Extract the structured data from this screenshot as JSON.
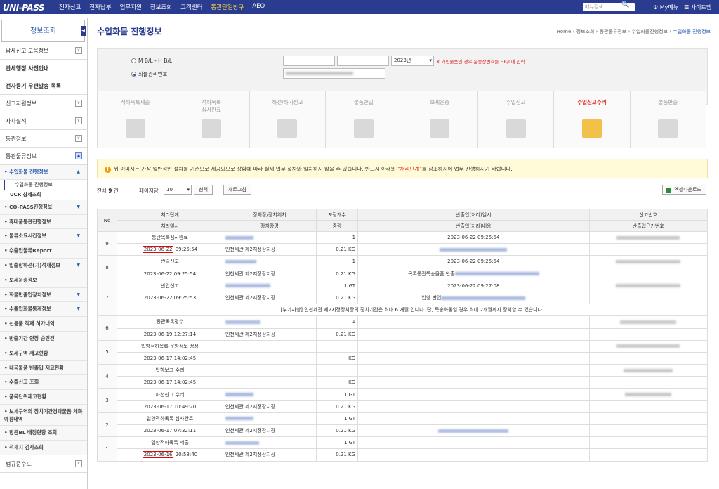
{
  "topbar": {
    "logo": "UNI-PASS",
    "menu": [
      "전자신고",
      "전자납부",
      "업무지원",
      "정보조회",
      "고객센터",
      "통관단일창구",
      "AEO"
    ],
    "search_placeholder": "메뉴검색",
    "my_menu": "My메뉴",
    "sitemap": "사이트맵"
  },
  "sidebar": {
    "title": "정보조회",
    "top_items": [
      {
        "label": "납세신고 도움정보",
        "toggle": "∨"
      },
      {
        "label": "관세행정 사전안내",
        "toggle": ""
      },
      {
        "label": "전자등기 우편발송 목록",
        "toggle": ""
      },
      {
        "label": "신고지원정보",
        "toggle": "∨"
      },
      {
        "label": "자사실적",
        "toggle": "∨"
      },
      {
        "label": "통관정보",
        "toggle": "∨"
      },
      {
        "label": "통관물류정보",
        "toggle": "▲"
      }
    ],
    "sub_open": "수입화물 진행정보",
    "leaf_active": "수입화물 진행정보",
    "leaf2": "UCR 상세조회",
    "subs": [
      {
        "label": "CO-PASS진행정보",
        "tri": "▼"
      },
      {
        "label": "휴대품통관진행정보",
        "tri": ""
      },
      {
        "label": "물류소요시간정보",
        "tri": "▼"
      },
      {
        "label": "수출입물류Report",
        "tri": ""
      },
      {
        "label": "입출항하선(기)적재정보",
        "tri": "▼"
      },
      {
        "label": "보세운송정보",
        "tri": ""
      },
      {
        "label": "화물반출입장치정보",
        "tri": "▼"
      },
      {
        "label": "수출입화물통계정보",
        "tri": "▼"
      },
      {
        "label": "선용품 적재 허가내역",
        "tri": ""
      },
      {
        "label": "반출기간 연장 승인건",
        "tri": ""
      },
      {
        "label": "보세구역 재고현황",
        "tri": ""
      },
      {
        "label": "내국물품 반출입 재고현황",
        "tri": ""
      },
      {
        "label": "수출신고 조회",
        "tri": ""
      },
      {
        "label": "품목단위재고현황",
        "tri": ""
      },
      {
        "label": "보세구역의 장치기간경과물품 체화 예정내역",
        "tri": ""
      },
      {
        "label": "항공BL 배정현황 조회",
        "tri": ""
      },
      {
        "label": "적재지 검사조회",
        "tri": ""
      }
    ],
    "bottom": "법규준수도"
  },
  "page": {
    "title": "수입화물 진행정보",
    "breadcrumb": [
      "Home",
      "정보조회",
      "통관물류정보",
      "수입화물진행정보",
      "수입화물 진행정보"
    ]
  },
  "search": {
    "opt1": "M B/L - H B/L",
    "opt2": "화물관리번호",
    "year": "2023년",
    "warn": "✕ 가인물품인 경우 운송장번호를 HB/L에 입력"
  },
  "steps": [
    {
      "label": "적하목록제출"
    },
    {
      "label": "적하목록\n심사완료"
    },
    {
      "label": "하선/하기신고"
    },
    {
      "label": "물품반입"
    },
    {
      "label": "보세운송"
    },
    {
      "label": "수입신고"
    },
    {
      "label": "수입신고수리"
    },
    {
      "label": "물품반출"
    }
  ],
  "notice": {
    "pre": "위 이미지는 가장 일반적인 절차를 기준으로 제공되므로 상황에 따라 실제 업무 절차와 일치하지 않을 수 있습니다. 반드시 아래의 ",
    "hl": "\"처리단계\"",
    "post": "를 참조하시어 업무 진행하시기 바랍니다."
  },
  "controls": {
    "total_pre": "전체 ",
    "total": "9",
    "total_post": " 건",
    "per_page": "페이지당",
    "per_page_val": "10",
    "select": "선택",
    "refresh": "새로고침",
    "excel": "엑셀다운로드"
  },
  "table": {
    "h1": [
      "No",
      "처리단계",
      "장치장/장치위치",
      "포장개수",
      "반출입(처리)일시",
      "신고번호"
    ],
    "h2": [
      "처리일시",
      "장치장명",
      "중량",
      "반출입(처리)내용",
      "반출입근거번호"
    ],
    "rows": [
      {
        "no": "9",
        "step": "통관목록심사완료",
        "date": "2023-06-22",
        "time": " 09:25:54",
        "place": "인천세관 제2지정장치장",
        "cnt": "1",
        "wt": "0.21 KG",
        "io_dt": "2023-06-22 09:25:54",
        "io_txt": "",
        "box": true
      },
      {
        "no": "8",
        "step": "반출신고",
        "date": "2023-06-22",
        "time": " 09:25:54",
        "place": "인천세관 제2지정장치장",
        "cnt": "1",
        "wt": "0.21 KG",
        "io_dt": "2023-06-22 09:25:54",
        "io_txt": "목록통관특송물품 반출",
        "box": false
      },
      {
        "no": "7",
        "step": "반입신고",
        "date": "2023-06-22",
        "time": " 09:25:53",
        "place": "인천세관 제2지정장치장",
        "cnt": "1 GT",
        "wt": "0.21 KG",
        "io_dt": "2023-06-22 09:27:08",
        "io_txt": "입항 반입",
        "box": false,
        "note": "[부가사항] 인천세관 제2지정장치장의 장치기간은 최대 6 개월 입니다. 단, 특송화물일 경우 최대 2개월까지 장치할 수 있습니다."
      },
      {
        "no": "6",
        "step": "통관목록접수",
        "date": "2023-06-19",
        "time": " 12:27:14",
        "place": "인천세관 제2지정장치장",
        "cnt": "1",
        "wt": "0.21 KG",
        "io_dt": "",
        "io_txt": "",
        "box": false
      },
      {
        "no": "5",
        "step": "입항적하목록 운항정보 정정",
        "date": "2023-06-17",
        "time": " 14:02:45",
        "place": "",
        "cnt": "",
        "wt": "KG",
        "io_dt": "",
        "io_txt": "",
        "box": false
      },
      {
        "no": "4",
        "step": "입항보고 수리",
        "date": "2023-06-17",
        "time": " 14:02:45",
        "place": "",
        "cnt": "",
        "wt": "KG",
        "io_dt": "",
        "io_txt": "",
        "box": false
      },
      {
        "no": "3",
        "step": "하선신고 수리",
        "date": "2023-06-17",
        "time": " 10:49:20",
        "place": "인천세관 제2지정장치장",
        "cnt": "1 GT",
        "wt": "0.21 KG",
        "io_dt": "",
        "io_txt": "",
        "box": false
      },
      {
        "no": "2",
        "step": "입항적하목록 심사완료",
        "date": "2023-06-17",
        "time": " 07:32:11",
        "place": "인천세관 제2지정장치장",
        "cnt": "1 GT",
        "wt": "0.21 KG",
        "io_dt": "",
        "io_txt": "",
        "box": false
      },
      {
        "no": "1",
        "step": "입항적하목록 제출",
        "date": "2023-06-16",
        "time": " 20:58:40",
        "place": "인천세관 제2지정장치장",
        "cnt": "1 GT",
        "wt": "0.21 KG",
        "io_dt": "",
        "io_txt": "",
        "box": true
      }
    ]
  }
}
